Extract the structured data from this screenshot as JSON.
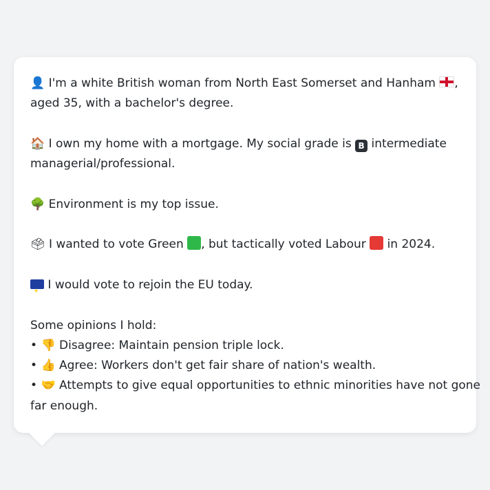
{
  "card": {
    "p1": {
      "icon": "person-silhouette-icon",
      "text1": "I'm a white British woman from North East Somerset and Hanham",
      "flag_icon": "england-flag-icon",
      "text2": ",",
      "text3": "aged 35, with a bachelor's degree."
    },
    "p2": {
      "icon": "house-icon",
      "text1": "I own my home with a mortgage. My social grade is",
      "badge": "B",
      "text2": "intermediate",
      "text3": "managerial/professional."
    },
    "p3": {
      "icon": "tree-icon",
      "text1": "Environment is my top issue."
    },
    "p4": {
      "icon": "ballot-box-icon",
      "text1": "I wanted to vote Green",
      "green_icon": "green-square-icon",
      "text2": ", but tactically voted Labour",
      "red_icon": "red-square-icon",
      "text3": "in 2024."
    },
    "p5": {
      "icon": "eu-flag-icon",
      "text1": "I would vote to rejoin the EU today."
    },
    "opinions": {
      "heading": "Some opinions I hold:",
      "items": [
        {
          "bullet": "•",
          "icon": "thumbs-down-icon",
          "text": "Disagree: Maintain pension triple lock."
        },
        {
          "bullet": "•",
          "icon": "thumbs-up-icon",
          "text": "Agree: Workers don't get fair share of nation's wealth."
        },
        {
          "bullet": "•",
          "icon": "handshake-icon",
          "text": "Attempts to give equal opportunities to ethnic minorities have not gone",
          "text2": "far enough."
        }
      ]
    }
  },
  "colors": {
    "background": "#f2f3f5",
    "card": "#ffffff",
    "text": "#1f2328",
    "green": "#2fb84a",
    "red": "#e53935"
  }
}
